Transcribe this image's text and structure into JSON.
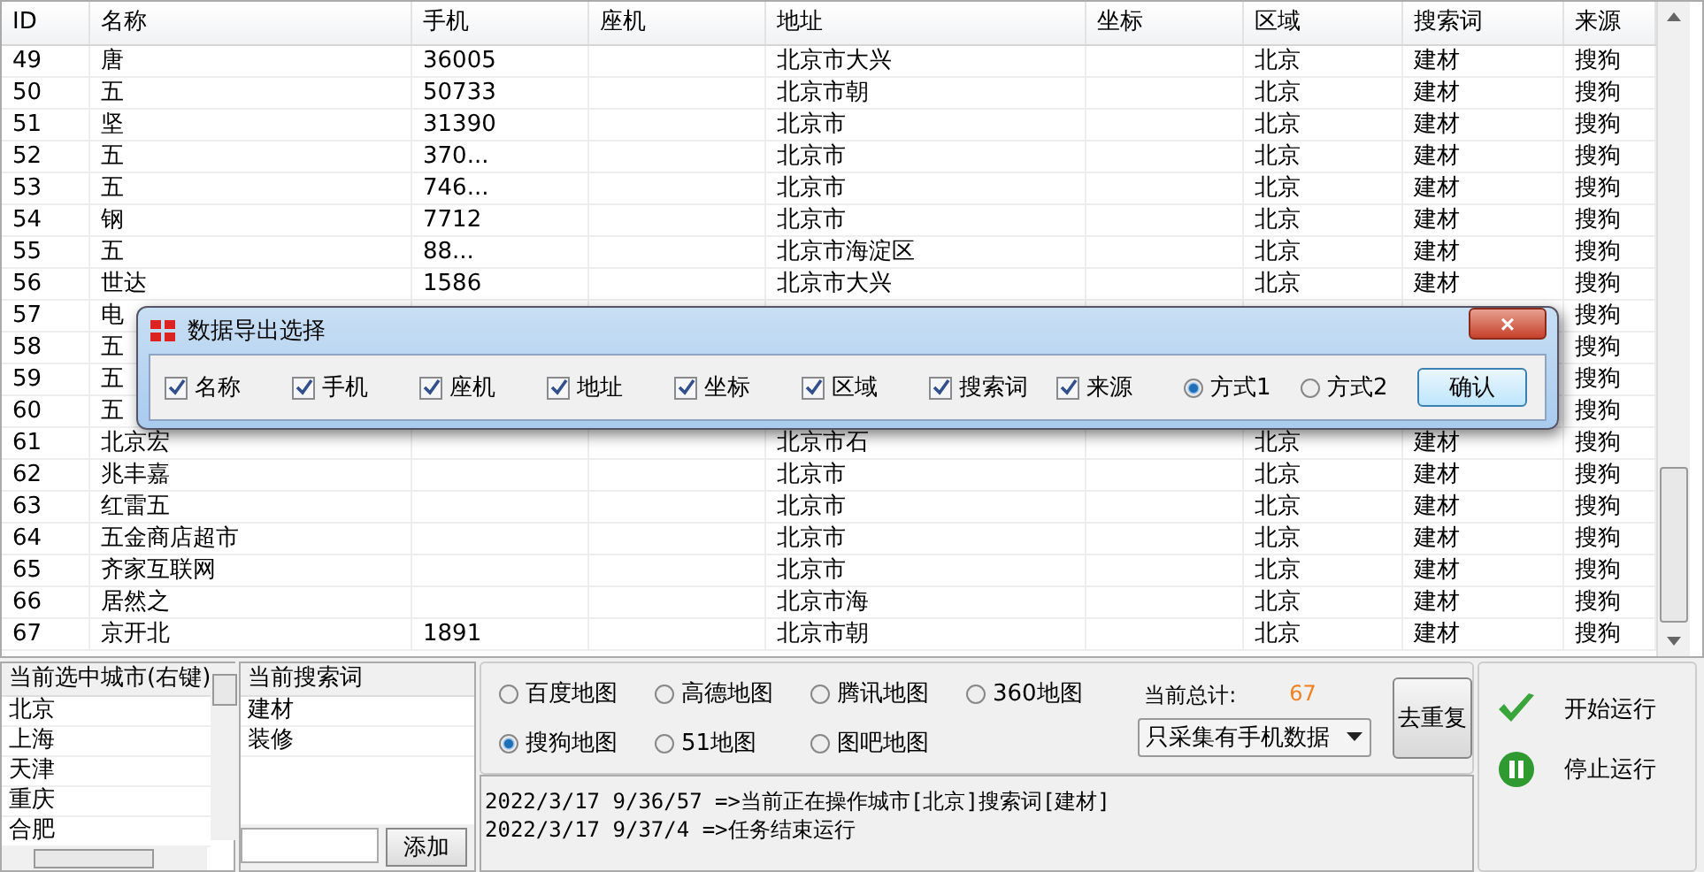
{
  "table": {
    "columns": [
      "ID",
      "名称",
      "手机",
      "座机",
      "地址",
      "坐标",
      "区域",
      "搜索词",
      "来源"
    ],
    "rows": [
      {
        "id": "49",
        "name": "唐",
        "phone": "36005",
        "address": "北京市大兴",
        "region": "北京",
        "keyword": "建材",
        "source": "搜狗"
      },
      {
        "id": "50",
        "name": "五",
        "phone": "50733",
        "address": "北京市朝",
        "region": "北京",
        "keyword": "建材",
        "source": "搜狗"
      },
      {
        "id": "51",
        "name": "坚",
        "phone": "31390",
        "address": "北京市",
        "region": "北京",
        "keyword": "建材",
        "source": "搜狗"
      },
      {
        "id": "52",
        "name": "五",
        "phone": "370...",
        "address": "北京市",
        "region": "北京",
        "keyword": "建材",
        "source": "搜狗"
      },
      {
        "id": "53",
        "name": "五",
        "phone": "746...",
        "address": "北京市",
        "region": "北京",
        "keyword": "建材",
        "source": "搜狗"
      },
      {
        "id": "54",
        "name": "钢",
        "phone": "7712",
        "address": "北京市",
        "region": "北京",
        "keyword": "建材",
        "source": "搜狗"
      },
      {
        "id": "55",
        "name": "五",
        "phone": "88...",
        "address": "北京市海淀区",
        "region": "北京",
        "keyword": "建材",
        "source": "搜狗"
      },
      {
        "id": "56",
        "name": "世达",
        "phone": "1586",
        "address": "北京市大兴",
        "region": "北京",
        "keyword": "建材",
        "source": "搜狗"
      },
      {
        "id": "57",
        "name": "电",
        "source": "搜狗"
      },
      {
        "id": "58",
        "name": "五",
        "source": "搜狗"
      },
      {
        "id": "59",
        "name": "五",
        "source": "搜狗"
      },
      {
        "id": "60",
        "name": "五",
        "source": "搜狗"
      },
      {
        "id": "61",
        "name": "北京宏",
        "address": "北京市石",
        "region": "北京",
        "keyword": "建材",
        "source": "搜狗"
      },
      {
        "id": "62",
        "name": "兆丰嘉",
        "address": "北京市",
        "region": "北京",
        "keyword": "建材",
        "source": "搜狗"
      },
      {
        "id": "63",
        "name": "红雷五",
        "address": "北京市",
        "region": "北京",
        "keyword": "建材",
        "source": "搜狗"
      },
      {
        "id": "64",
        "name": "五金商店超市",
        "address": "北京市",
        "region": "北京",
        "keyword": "建材",
        "source": "搜狗"
      },
      {
        "id": "65",
        "name": "齐家互联网",
        "address": "北京市",
        "region": "北京",
        "keyword": "建材",
        "source": "搜狗"
      },
      {
        "id": "66",
        "name": "居然之",
        "address": "北京市海",
        "region": "北京",
        "keyword": "建材",
        "source": "搜狗"
      },
      {
        "id": "67",
        "name": "京开北",
        "phone": "1891",
        "address": "北京市朝",
        "region": "北京",
        "keyword": "建材",
        "source": "搜狗"
      }
    ]
  },
  "dialog": {
    "title": "数据导出选择",
    "close": "×",
    "fields": [
      {
        "label": "名称",
        "checked": true
      },
      {
        "label": "手机",
        "checked": true
      },
      {
        "label": "座机",
        "checked": true
      },
      {
        "label": "地址",
        "checked": true
      },
      {
        "label": "坐标",
        "checked": true
      },
      {
        "label": "区域",
        "checked": true
      },
      {
        "label": "搜索词",
        "checked": true
      },
      {
        "label": "来源",
        "checked": true
      }
    ],
    "modes": [
      {
        "label": "方式1",
        "selected": true
      },
      {
        "label": "方式2",
        "selected": false
      }
    ],
    "confirm": "确认"
  },
  "cities": {
    "header": "当前选中城市(右键)",
    "items": [
      "北京",
      "上海",
      "天津",
      "重庆",
      "合肥"
    ]
  },
  "keywords": {
    "header": "当前搜索词",
    "items": [
      "建材",
      "装修"
    ],
    "add": "添加"
  },
  "maps": [
    {
      "label": "百度地图",
      "selected": false
    },
    {
      "label": "高德地图",
      "selected": false
    },
    {
      "label": "腾讯地图",
      "selected": false
    },
    {
      "label": "360地图",
      "selected": false
    },
    {
      "label": "搜狗地图",
      "selected": true
    },
    {
      "label": "51地图",
      "selected": false
    },
    {
      "label": "图吧地图",
      "selected": false
    }
  ],
  "total": {
    "label": "当前总计:",
    "value": "67"
  },
  "filter": "只采集有手机数据",
  "dedupe": "去重复",
  "log": [
    "2022/3/17 9/36/57 =>当前正在操作城市[北京]搜索词[建材]",
    "2022/3/17 9/37/4 =>任务结束运行"
  ],
  "actions": [
    {
      "kind": "start",
      "label": "开始运行"
    },
    {
      "kind": "stop",
      "label": "停止运行"
    }
  ]
}
